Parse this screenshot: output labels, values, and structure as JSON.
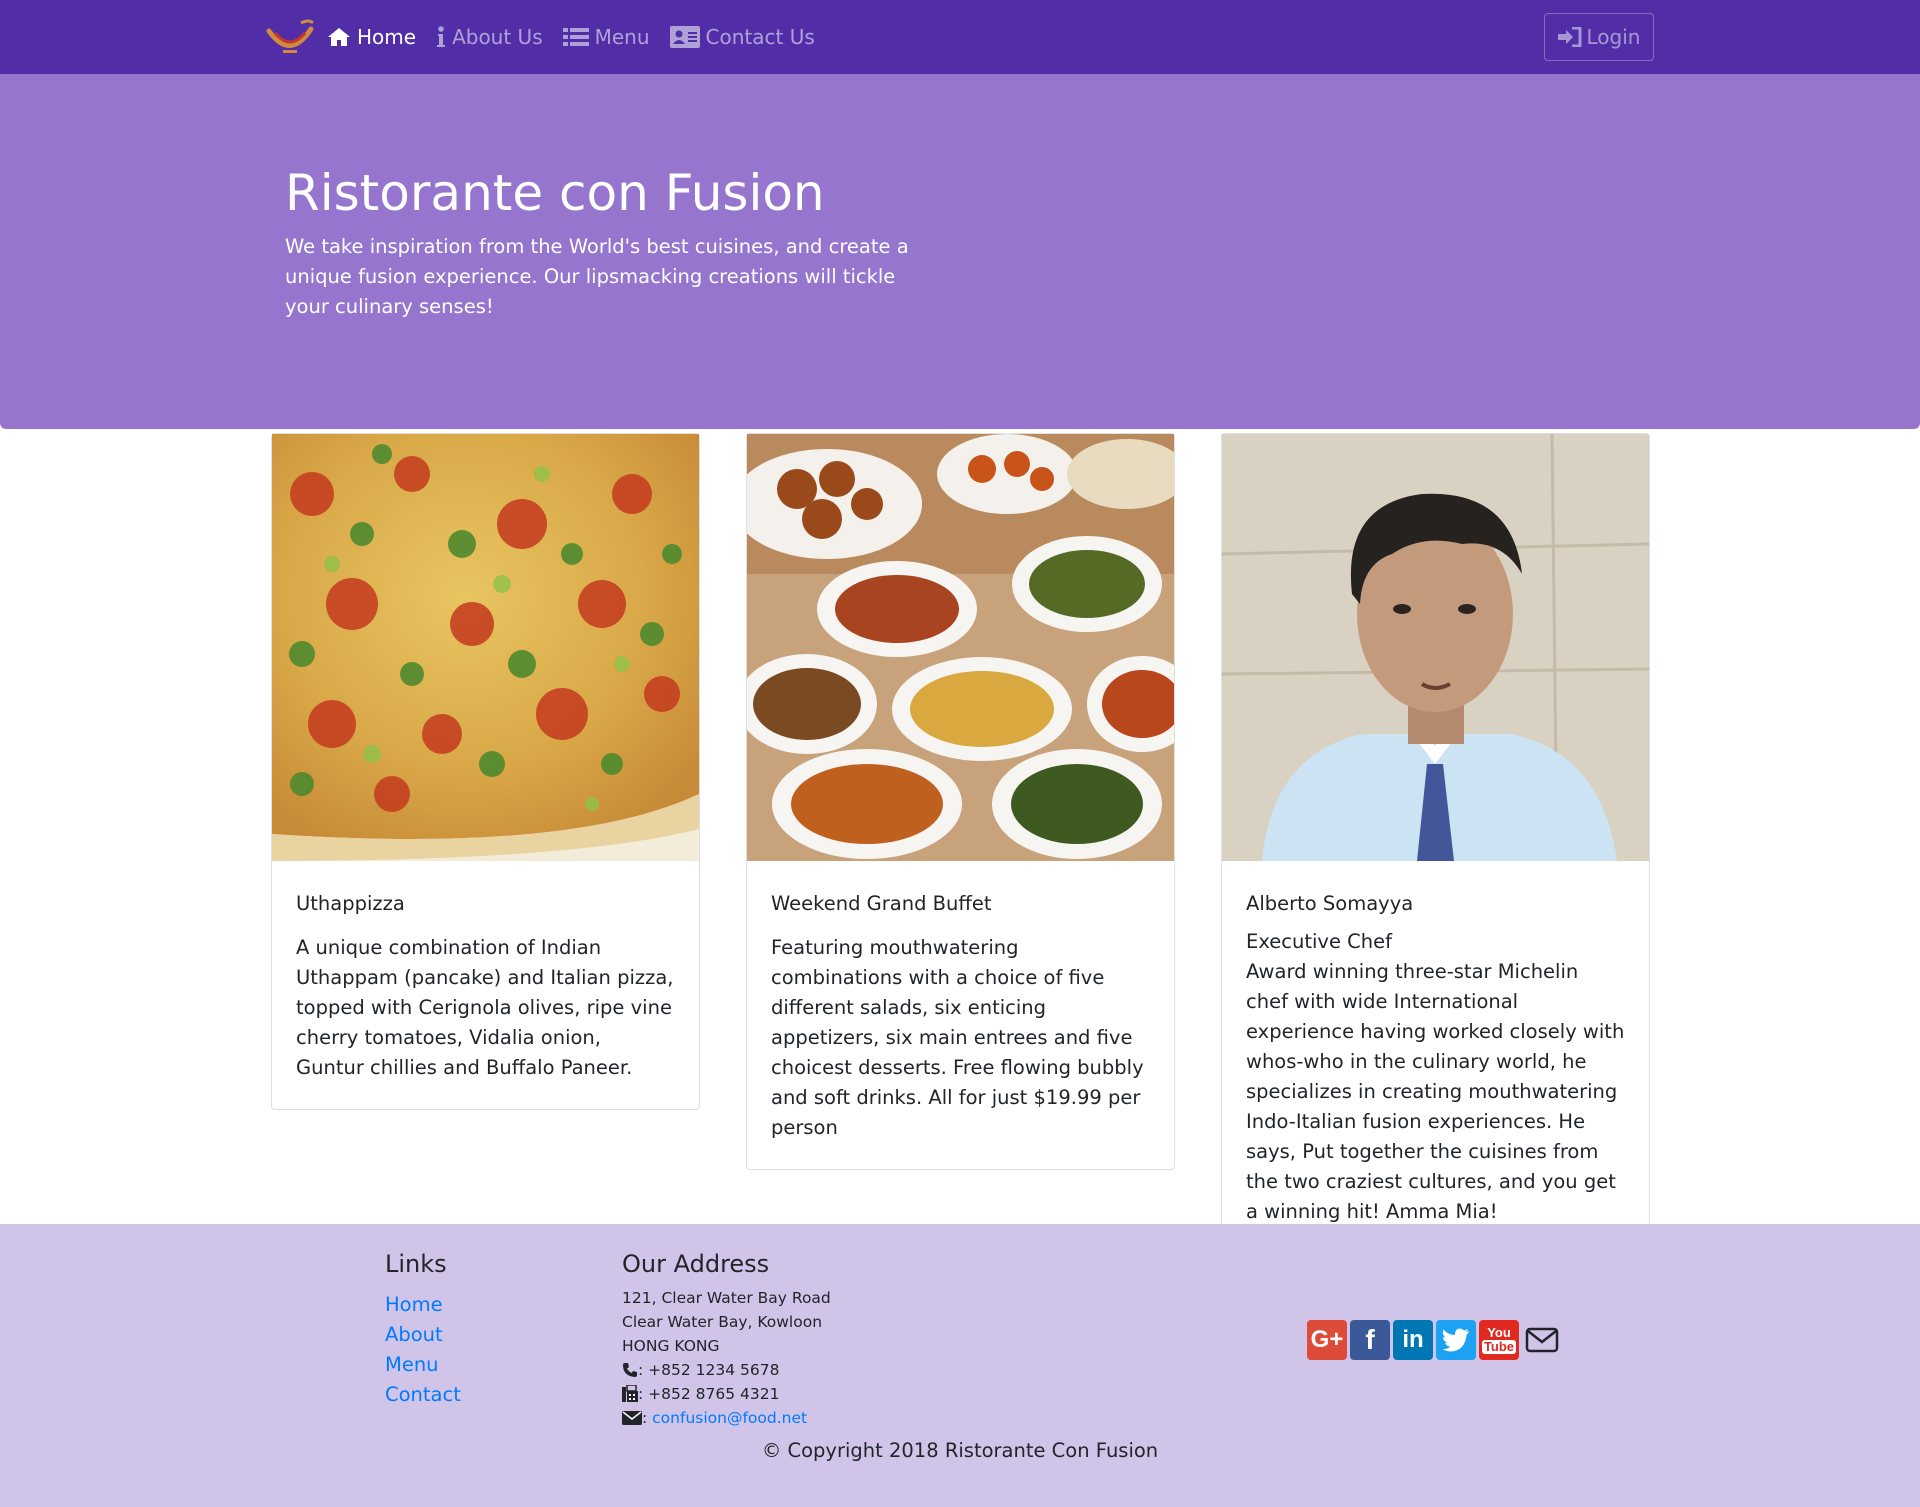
{
  "nav": {
    "items": [
      {
        "label": "Home",
        "icon": "home-icon"
      },
      {
        "label": "About Us",
        "icon": "info-icon"
      },
      {
        "label": "Menu",
        "icon": "list-icon"
      },
      {
        "label": "Contact Us",
        "icon": "address-card-icon"
      }
    ],
    "login_label": "Login"
  },
  "jumbotron": {
    "title": "Ristorante con Fusion",
    "text": "We take inspiration from the World's best cuisines, and create a unique fusion experience. Our lipsmacking creations will tickle your culinary senses!"
  },
  "cards": [
    {
      "title": "Uthappizza",
      "text": "A unique combination of Indian Uthappam (pancake) and Italian pizza, topped with Cerignola olives, ripe vine cherry tomatoes, Vidalia onion, Guntur chillies and Buffalo Paneer."
    },
    {
      "title": "Weekend Grand Buffet",
      "text": "Featuring mouthwatering combinations with a choice of five different salads, six enticing appetizers, six main entrees and five choicest desserts. Free flowing bubbly and soft drinks. All for just $19.99 per person"
    },
    {
      "title": "Alberto Somayya",
      "subtitle": "Executive Chef",
      "text": "Award winning three-star Michelin chef with wide International experience having worked closely with whos-who in the culinary world, he specializes in creating mouthwatering Indo-Italian fusion experiences. He says, Put together the cuisines from the two craziest cultures, and you get a winning hit! Amma Mia!"
    }
  ],
  "footer": {
    "links_title": "Links",
    "links": [
      "Home",
      "About",
      "Menu",
      "Contact"
    ],
    "address_title": "Our Address",
    "address_lines": [
      "121, Clear Water Bay Road",
      "Clear Water Bay, Kowloon",
      "HONG KONG"
    ],
    "phone": ": +852 1234 5678",
    "fax": ": +852 8765 4321",
    "email": "confusion@food.net",
    "copyright": "© Copyright 2018 Ristorante Con Fusion"
  },
  "colors": {
    "navbar": "#512DA8",
    "jumbotron": "#9575CD",
    "footer": "#D1C4E9",
    "link": "#007bff"
  }
}
